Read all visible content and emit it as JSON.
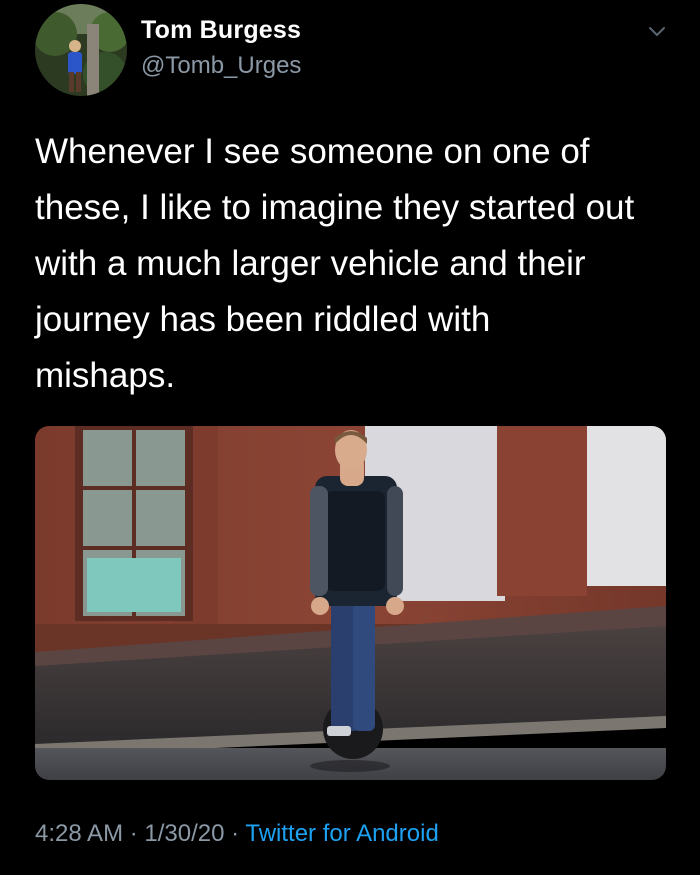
{
  "tweet": {
    "author": {
      "name": "Tom Burgess",
      "handle": "@Tomb_Urges",
      "avatar_icon": "profile-photo"
    },
    "menu_icon": "chevron-down-icon",
    "text": "Whenever I see someone on one of\nthese, I like to imagine they started out\nwith a much larger vehicle and their\njourney has been riddled with\nmishaps.",
    "media": {
      "kind": "photo",
      "icon": "man-on-electric-unicycle-photo"
    },
    "meta": {
      "time": "4:28 AM",
      "separator": " · ",
      "date": "1/30/20",
      "source": "Twitter for Android"
    }
  },
  "colors": {
    "background": "#000000",
    "text_primary": "#ffffff",
    "text_secondary": "#8b98a5",
    "link": "#1da1f2"
  }
}
